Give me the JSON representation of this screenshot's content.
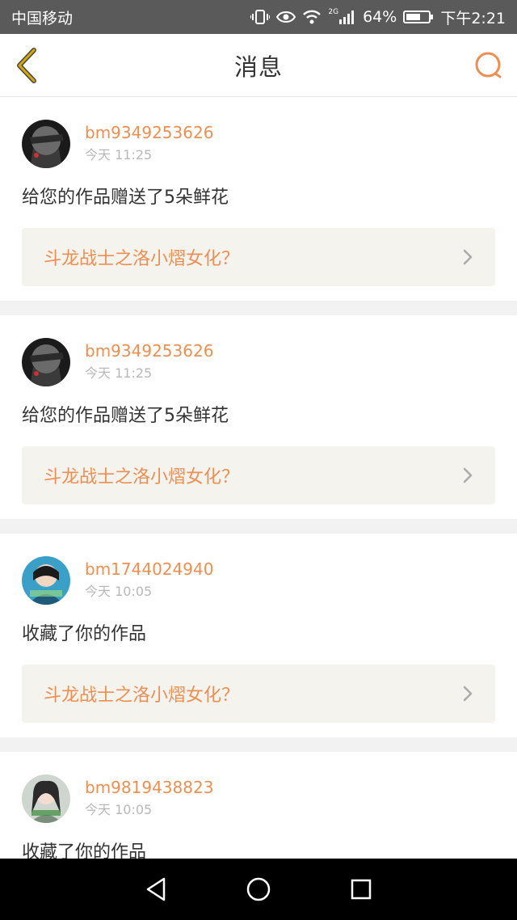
{
  "status_bar": {
    "carrier": "中国移动",
    "network": "2G",
    "battery": "64%",
    "battery_level": 0.64,
    "time": "下午2:21"
  },
  "header": {
    "title": "消息",
    "back_icon": "chevron-left-icon",
    "search_icon": "search-icon"
  },
  "colors": {
    "accent": "#ec8f52",
    "back_icon": "#d4a800",
    "card_link_bg": "#f4f3ee"
  },
  "messages": [
    {
      "username": "bm9349253626",
      "time": "今天 11:25",
      "action": "给您的作品赠送了5朵鲜花",
      "work_title": "斗龙战士之洛小熠女化？"
    },
    {
      "username": "bm9349253626",
      "time": "今天 11:25",
      "action": "给您的作品赠送了5朵鲜花",
      "work_title": "斗龙战士之洛小熠女化？"
    },
    {
      "username": "bm1744024940",
      "time": "今天 10:05",
      "action": "收藏了你的作品",
      "work_title": "斗龙战士之洛小熠女化？"
    },
    {
      "username": "bm9819438823",
      "time": "今天 10:05",
      "action": "收藏了你的作品",
      "work_title": ""
    }
  ],
  "nav_bar": {
    "back": "triangle-back-icon",
    "home": "circle-home-icon",
    "recents": "square-recents-icon"
  }
}
